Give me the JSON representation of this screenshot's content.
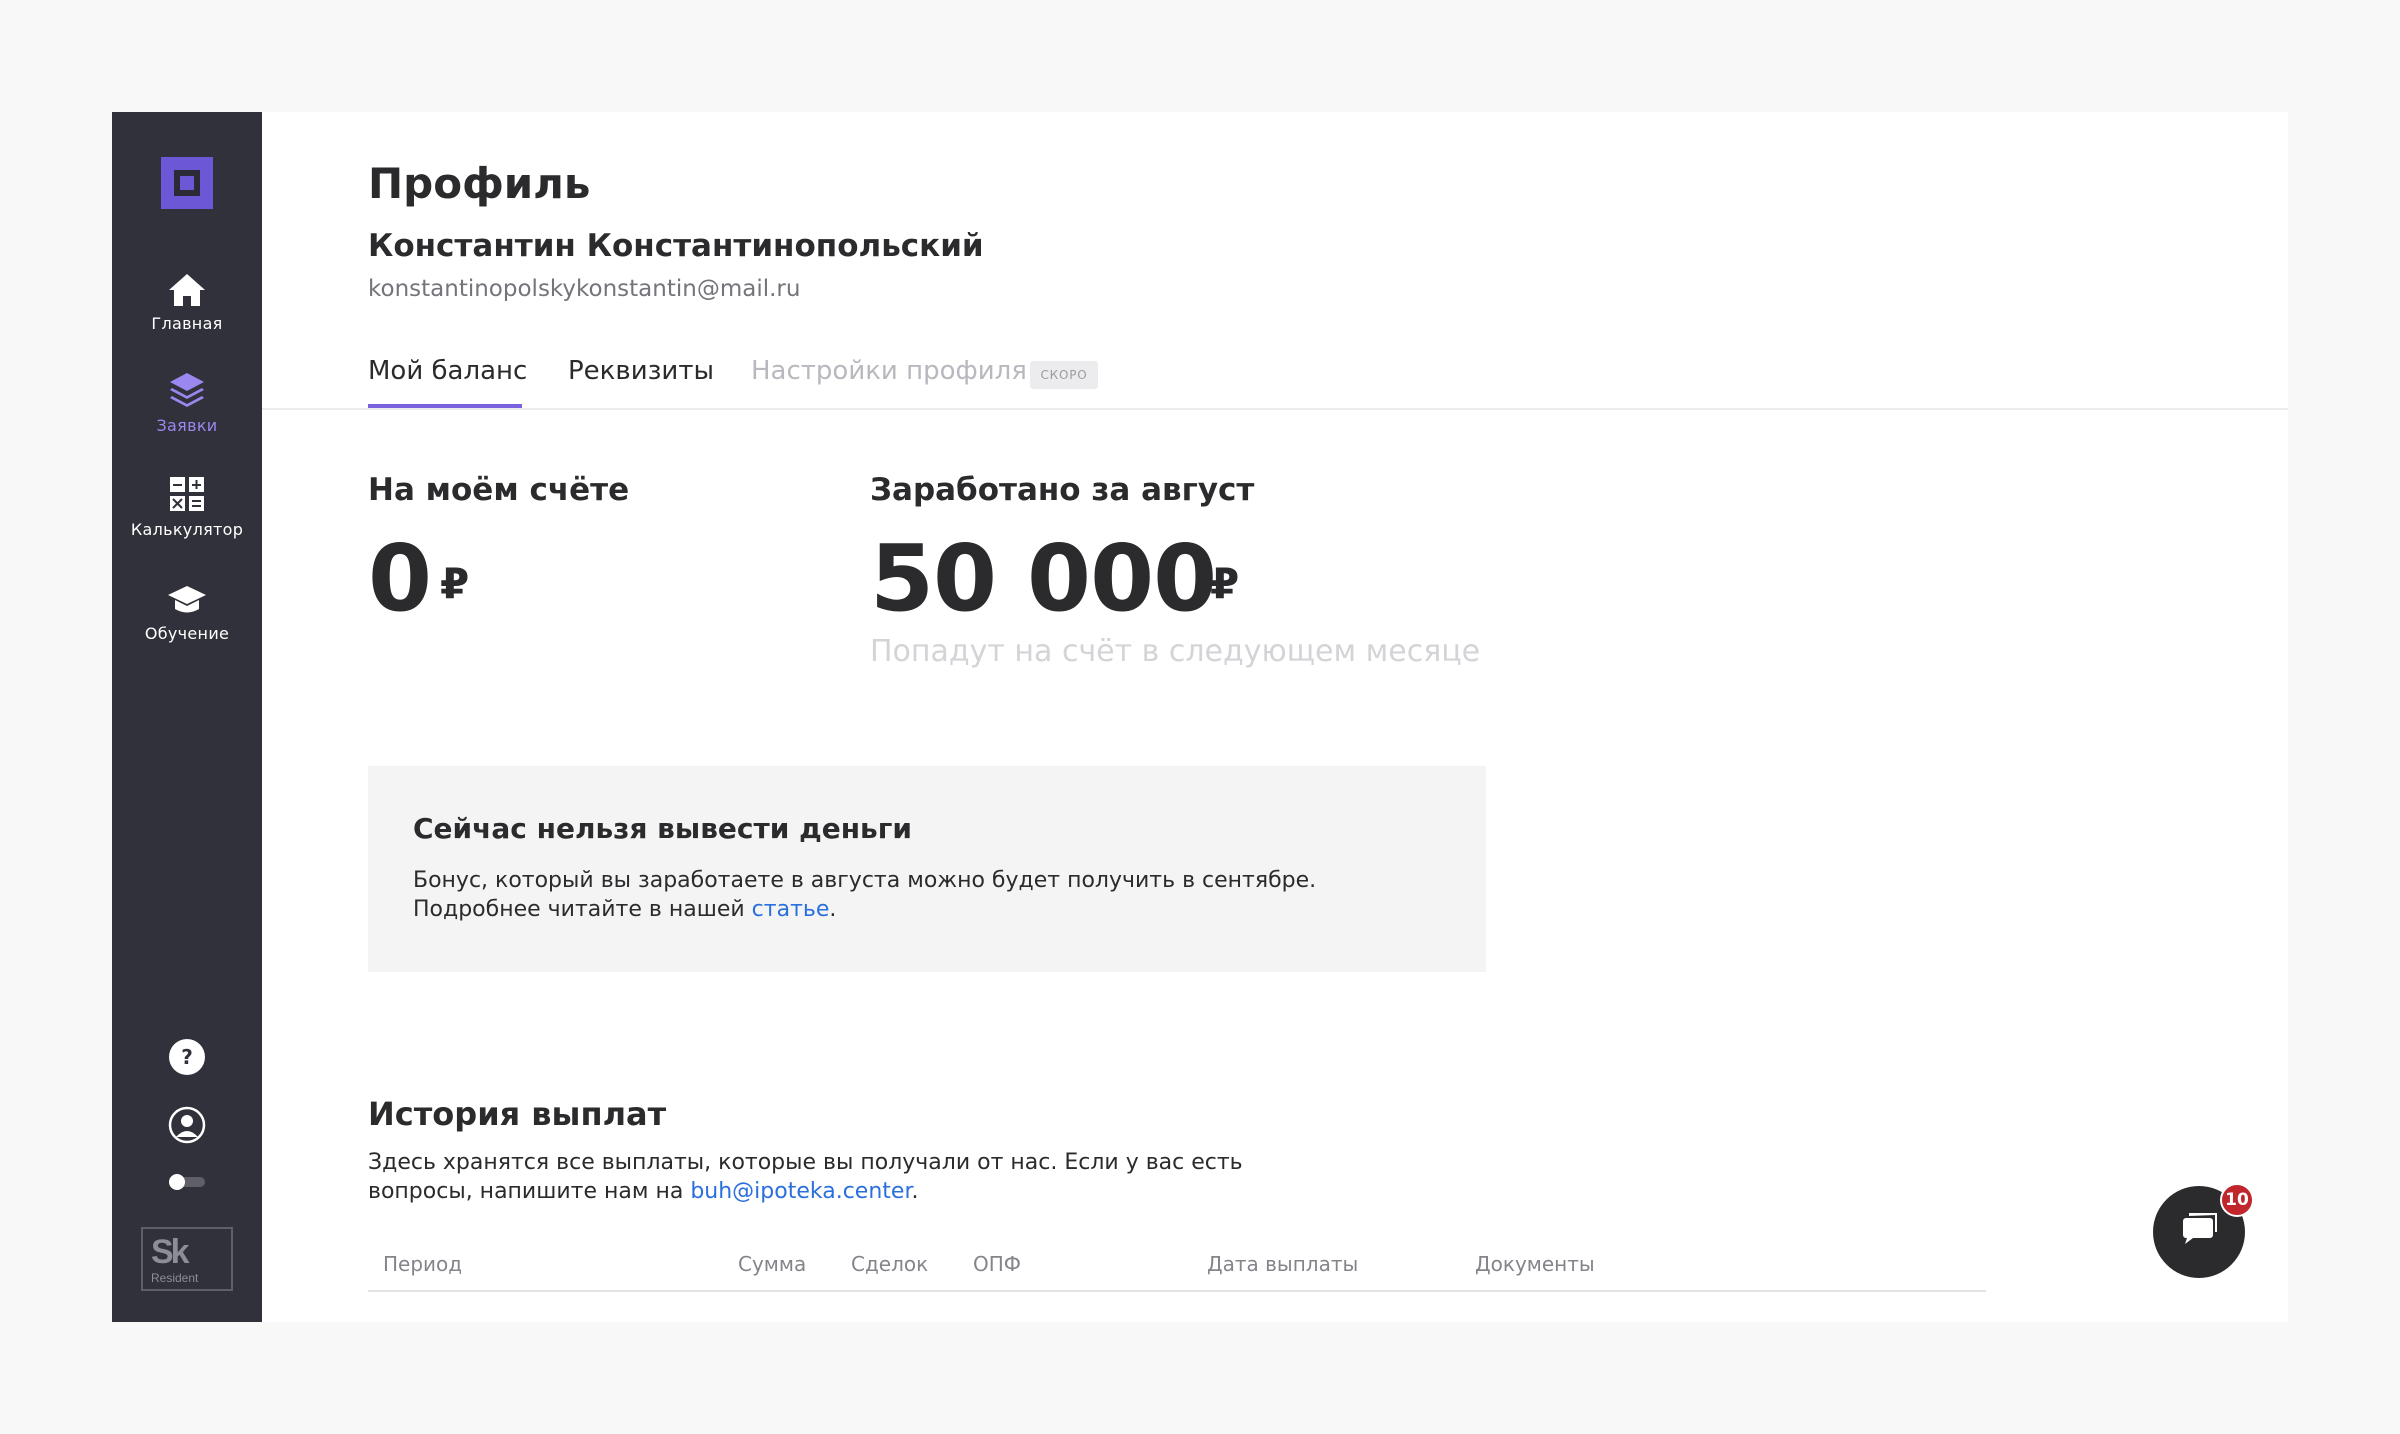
{
  "sidebar": {
    "items": [
      {
        "label": "Главная",
        "icon": "home-icon"
      },
      {
        "label": "Заявки",
        "icon": "layers-icon"
      },
      {
        "label": "Калькулятор",
        "icon": "calculator-icon"
      },
      {
        "label": "Обучение",
        "icon": "graduation-cap-icon"
      }
    ],
    "active": "Заявки",
    "bottom_icons": [
      "help-icon",
      "user-icon",
      "toggle-icon"
    ],
    "sk_logo": {
      "big": "Sk",
      "small": "Resident"
    }
  },
  "header": {
    "title": "Профиль",
    "user_name": "Константин Константинопольский",
    "email": "konstantinopolskykonstantin@mail.ru"
  },
  "tabs": [
    {
      "label": "Мой баланс",
      "active": true
    },
    {
      "label": "Реквизиты",
      "active": false
    },
    {
      "label": "Настройки профиля",
      "active": false,
      "disabled": true,
      "badge": "СКОРО"
    }
  ],
  "balance": {
    "label": "На моём счёте",
    "value": "0",
    "currency": "₽"
  },
  "earned": {
    "label": "Заработано за август",
    "value": "50 000",
    "currency": "₽",
    "hint": "Попадут на счёт в следующем месяце"
  },
  "notice": {
    "title": "Сейчас нельзя вывести деньги",
    "line1": "Бонус, который вы заработаете в августа можно будет получить в сентябре.",
    "line2_prefix": "Подробнее читайте в нашей ",
    "link": "статье",
    "line2_suffix": "."
  },
  "history": {
    "title": "История выплат",
    "line1": "Здесь хранятся все выплаты, которые вы получали от нас. Если у вас есть",
    "line2_prefix": "вопросы, напишите нам на ",
    "email": "buh@ipoteka.center",
    "line2_suffix": ".",
    "columns": [
      "Период",
      "Сумма",
      "Сделок",
      "ОПФ",
      "Дата выплаты",
      "Документы"
    ]
  },
  "chat": {
    "badge": "10"
  },
  "colors": {
    "accent": "#7b63e0",
    "sidebar": "#31313b",
    "link": "#2a6fde",
    "badge": "#c0262c"
  }
}
